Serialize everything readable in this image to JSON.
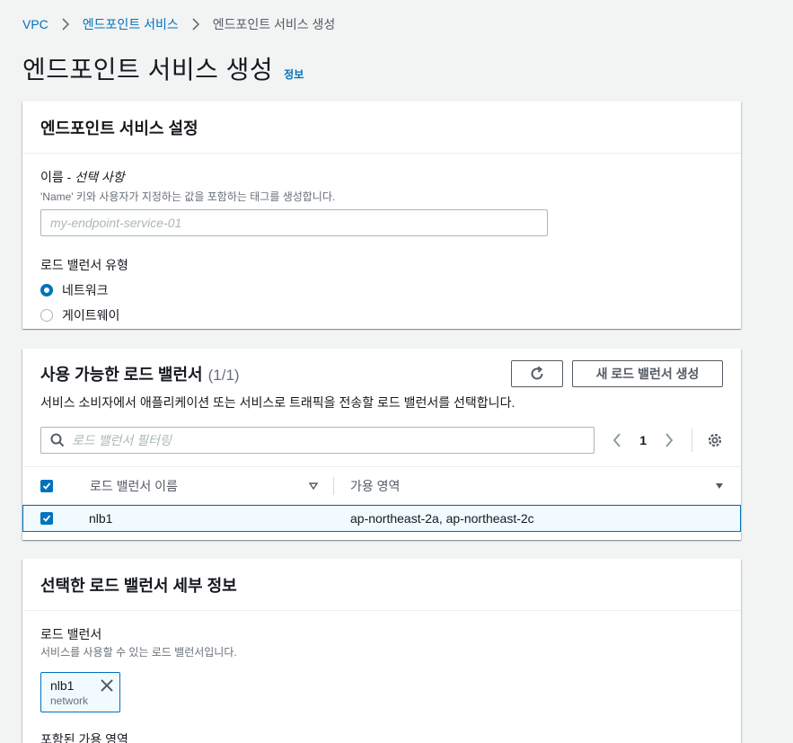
{
  "breadcrumb": {
    "items": [
      "VPC",
      "엔드포인트 서비스",
      "엔드포인트 서비스 생성"
    ]
  },
  "page": {
    "title": "엔드포인트 서비스 생성",
    "info_link": "정보"
  },
  "settings": {
    "header": "엔드포인트 서비스 설정",
    "name_label": "이름 - ",
    "name_optional": "선택 사항",
    "name_desc": "'Name' 키와 사용자가 지정하는 값을 포함하는 태그를 생성합니다.",
    "name_placeholder": "my-endpoint-service-01",
    "lb_type_label": "로드 밸런서 유형",
    "lb_type_options": [
      {
        "label": "네트워크",
        "checked": true
      },
      {
        "label": "게이트웨이",
        "checked": false
      }
    ]
  },
  "available": {
    "header": "사용 가능한 로드 밸런서",
    "count": "(1/1)",
    "create_button": "새 로드 밸런서 생성",
    "description": "서비스 소비자에서 애플리케이션 또는 서비스로 트래픽을 전송할 로드 밸런서를 선택합니다.",
    "filter_placeholder": "로드 밸런서 필터링",
    "page_number": "1",
    "columns": [
      "로드 밸런서 이름",
      "가용 영역"
    ],
    "rows": [
      {
        "name": "nlb1",
        "az": "ap-northeast-2a, ap-northeast-2c",
        "selected": true
      }
    ]
  },
  "details": {
    "header": "선택한 로드 밸런서 세부 정보",
    "lb_label": "로드 밸런서",
    "lb_desc": "서비스를 사용할 수 있는 로드 밸런서입니다.",
    "token_name": "nlb1",
    "token_type": "network",
    "az_label": "포함된 가용 영역"
  },
  "colors": {
    "link": "#0073bb",
    "primary": "#0073bb",
    "background": "#f2f3f3"
  }
}
